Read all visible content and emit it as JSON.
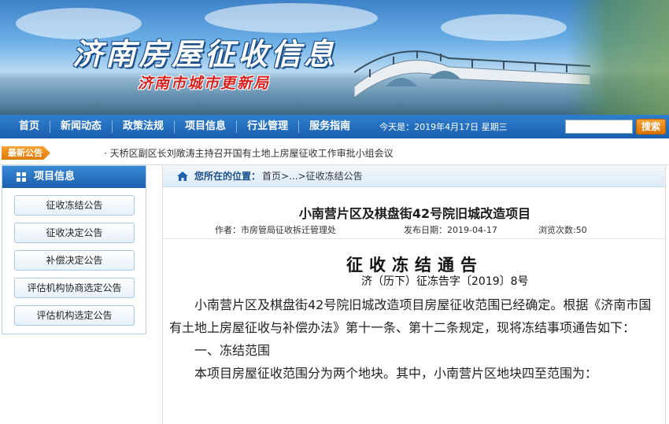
{
  "header": {
    "title": "济南房屋征收信息",
    "subtitle": "济南市城市更新局"
  },
  "nav": {
    "items": [
      "首页",
      "新闻动态",
      "政策法规",
      "项目信息",
      "行业管理",
      "服务指南"
    ],
    "date": "今天是：2019年4月17日 星期三",
    "search_value": "",
    "search_button": "搜索"
  },
  "announcement": {
    "badge": "最新公告",
    "text": "· 天桥区副区长刘敞涛主持召开国有土地上房屋征收工作审批小组会议"
  },
  "sidebar": {
    "title": "项目信息",
    "items": [
      "征收冻结公告",
      "征收决定公告",
      "补偿决定公告",
      "评估机构协商选定公告",
      "评估机构选定公告"
    ]
  },
  "breadcrumb": {
    "label": "您所在的位置：",
    "home": "首页",
    "sep": ">...",
    "current": ">征收冻结公告"
  },
  "article": {
    "title": "小南营片区及棋盘街42号院旧城改造项目",
    "author": "作者：市房管局征收拆迁管理处",
    "date": "发布日期：2019-04-17",
    "views": "浏览次数:50",
    "notice_title": "征收冻结通告",
    "notice_no": "济（历下）征冻告字〔2019〕8号",
    "para1": "小南营片区及棋盘街42号院旧城改造项目房屋征收范围已经确定。根据《济南市国有土地上房屋征收与补偿办法》第十一条、第十二条规定，现将冻结事项通告如下：",
    "section1": "一、冻结范围",
    "para2": "本项目房屋征收范围分为两个地块。其中，小南营片区地块四至范围为："
  },
  "colors": {
    "nav_blue": "#1a5fae",
    "accent_orange": "#e07a00",
    "title_red": "#d8221f"
  }
}
